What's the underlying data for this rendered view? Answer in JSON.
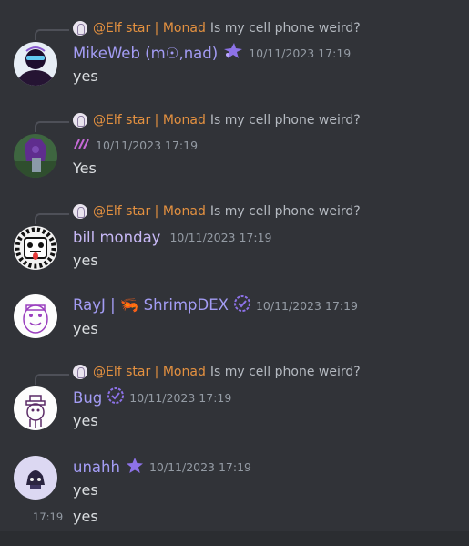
{
  "messages": [
    {
      "reply": {
        "author": "@Elf star | Monad",
        "text": "Is my cell phone weird?"
      },
      "username": "MikeWeb (m☉,nad)",
      "username_color": "#a39cf4",
      "timestamp": "10/11/2023 17:19",
      "content": "yes"
    },
    {
      "reply": {
        "author": "@Elf star | Monad",
        "text": "Is my cell phone weird?"
      },
      "username": "",
      "timestamp": "10/11/2023 17:19",
      "content": "Yes"
    },
    {
      "reply": {
        "author": "@Elf star | Monad",
        "text": "Is my cell phone weird?"
      },
      "username": "bill monday",
      "username_color": "#c7b8f5",
      "timestamp": "10/11/2023 17:19",
      "content": "yes"
    },
    {
      "username": "RayJ | 🦐 ShrimpDEX",
      "username_color": "#a39cf4",
      "timestamp": "10/11/2023 17:19",
      "content": "yes"
    },
    {
      "reply": {
        "author": "@Elf star | Monad",
        "text": "Is my cell phone weird?"
      },
      "username": "Bug",
      "username_color": "#a39cf4",
      "timestamp": "10/11/2023 17:19",
      "content": "yes"
    },
    {
      "username": "unahh",
      "username_color": "#a39cf4",
      "timestamp": "10/11/2023 17:19",
      "content": "yes"
    }
  ],
  "followup": {
    "time": "17:19",
    "content": "yes"
  },
  "colors": {
    "background": "#313338",
    "reply_author": "#e49140",
    "timestamp": "#949ba4",
    "badge": "#8d72e8"
  }
}
